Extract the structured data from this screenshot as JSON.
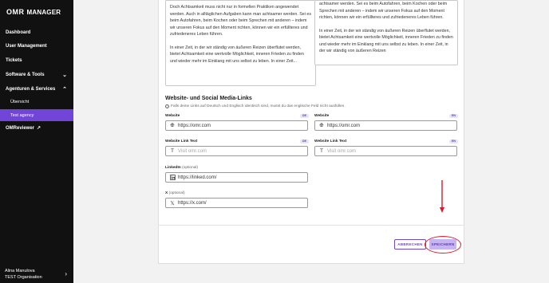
{
  "sidebar": {
    "logo": {
      "mark": "OMR",
      "text": "MANAGER"
    },
    "items": [
      {
        "label": "Dashboard"
      },
      {
        "label": "User Management"
      },
      {
        "label": "Tickets"
      },
      {
        "label": "Software & Tools"
      },
      {
        "label": "Agenturen & Services"
      },
      {
        "label": "Übersicht"
      },
      {
        "label": "Test agency"
      },
      {
        "label": "OMReviewer"
      }
    ],
    "user": {
      "name": "Alina Manulova",
      "org": "TEST Organisation"
    }
  },
  "description": {
    "de": [
      "Doch Achtsamkeit muss nicht nur in formellen Praktiken angewendet werden. Auch in alltäglichen Aufgaben kann man achtsamer werden. Sei es beim Autofahren, beim Kochen oder beim Sprechen mit anderen – indem wir unseren Fokus auf den Moment richten, können wir ein erfüllteres und zufriedeneres Leben führen.",
      "In einer Zeit, in der wir ständig von äußeren Reizen überflutet werden, bietet Achtsamkeit eine wertvolle Möglichkeit, inneren Frieden zu finden und wieder mehr im Einklang mit uns selbst zu leben. In einer Zeit..."
    ],
    "en": [
      "achtsamer werden. Sei es beim Autofahren, beim Kochen oder beim Sprechen mit anderen – indem wir unseren Fokus auf den Moment richten, können wir ein erfüllteres und zufriedeneres Leben führen.",
      "In einer Zeit, in der wir ständig von äußeren Reizen überflutet werden, bietet Achtsamkeit eine wertvolle Möglichkeit, inneren Frieden zu finden und wieder mehr im Einklang mit uns selbst zu leben. In einer Zeit, in der wir ständig von äußeren Reizen"
    ]
  },
  "links_section": {
    "title": "Website- und Social Media-Links",
    "hint": "Falls deine Links auf Deutsch und Englisch identisch sind, musst du das englische Feld nicht ausfüllen.",
    "website_label": "Website",
    "website_link_text_label": "Website Link Text",
    "badge_de": "DE",
    "badge_en": "EN",
    "website_de_value": "https://omr.com",
    "website_en_value": "https://omr.com",
    "link_text_de_placeholder": "Visit omr.com",
    "link_text_en_placeholder": "Visit omr.com",
    "linkedin_label": "LinkedIn",
    "linkedin_optional": "(optional)",
    "linkedin_value": "https://linked.com/",
    "x_label": "X",
    "x_optional": "(optional)",
    "x_value": "https://x.com/"
  },
  "actions": {
    "cancel_label": "ABBRECHEN",
    "save_label": "SPEICHERN"
  },
  "colors": {
    "sidebar_bg": "#111111",
    "accent": "#7045d8",
    "annotation_red": "#e0172a"
  }
}
